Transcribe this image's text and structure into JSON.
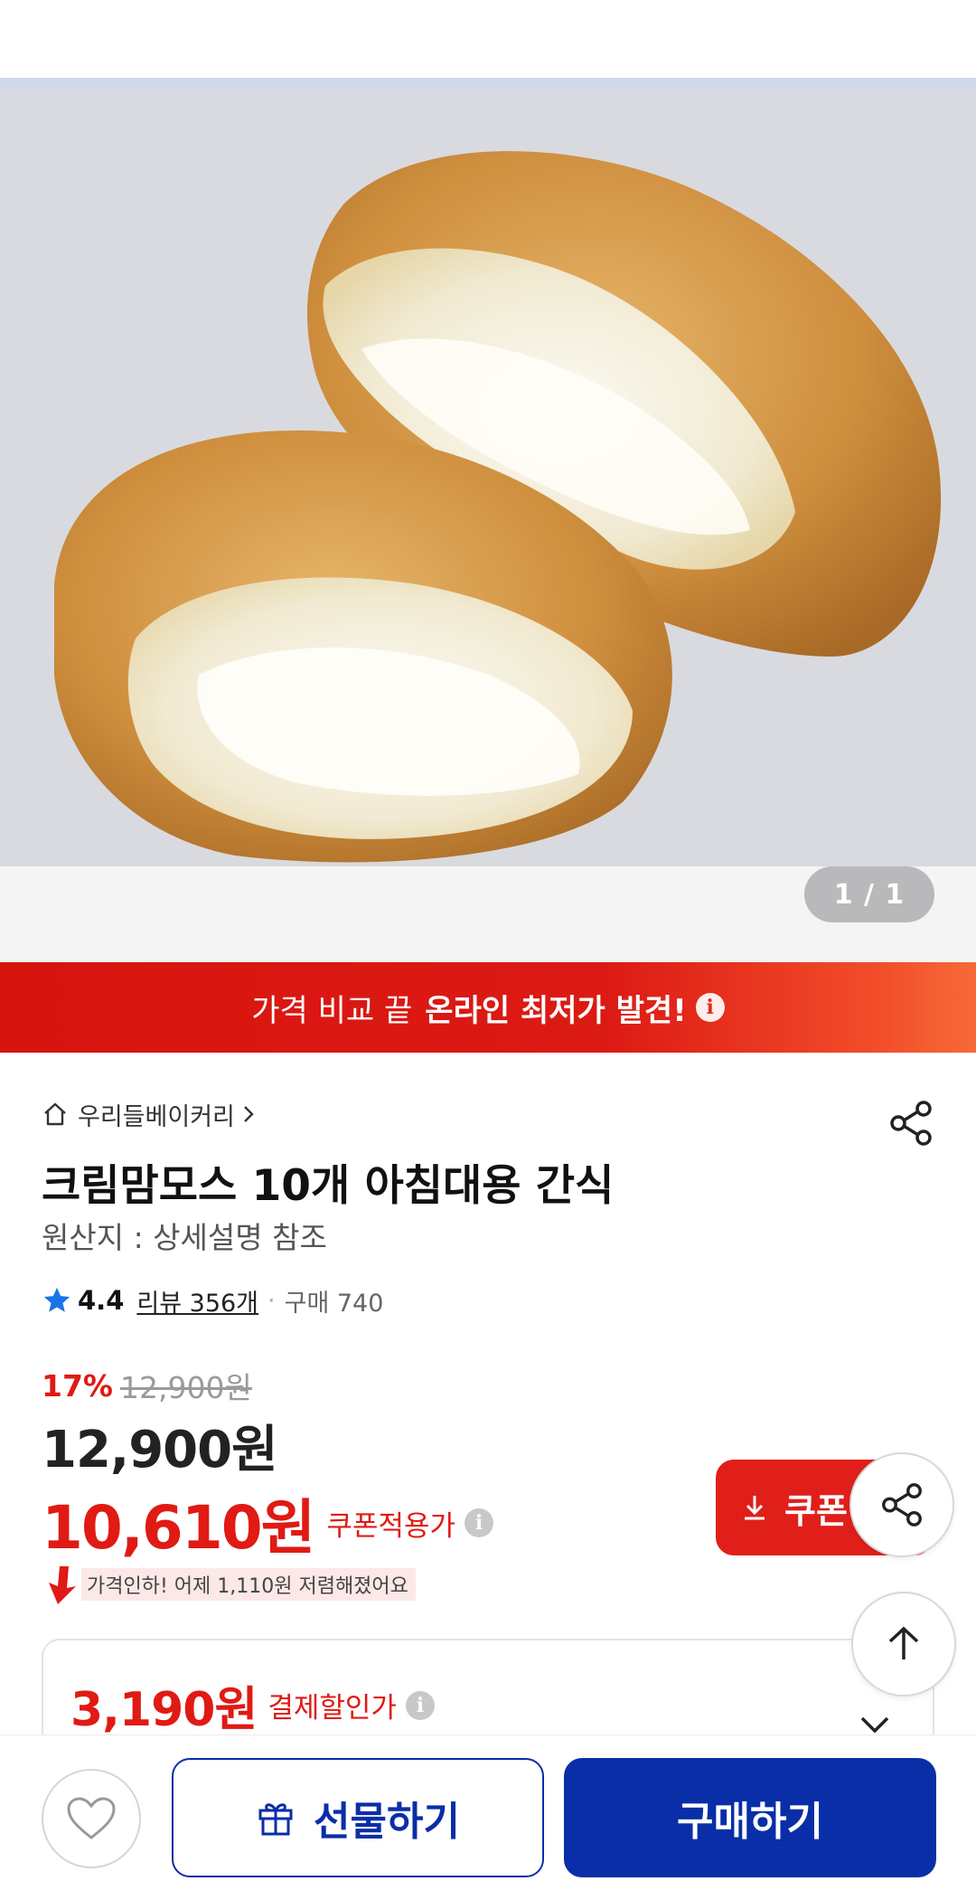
{
  "gallery": {
    "image_alt": "cream mammoth bread",
    "counter": "1 / 1"
  },
  "banner": {
    "text_normal": "가격 비교 끝",
    "text_strong": "온라인 최저가 발견!",
    "info_glyph": "i"
  },
  "product": {
    "store_name": "우리들베이커리",
    "title": "크림맘모스 10개 아침대용 간식",
    "origin": "원산지 : 상세설명 참조",
    "rating": "4.4",
    "reviews": "리뷰 356개",
    "separator": "·",
    "purchases": "구매 740"
  },
  "pricing": {
    "discount_pct": "17%",
    "original_price": "12,900원",
    "price": "12,900원",
    "coupon_price": "10,610원",
    "coupon_label": "쿠폰적용가",
    "coupon_button": "쿠폰받",
    "price_drop_note": "가격인하! 어제 1,110원 저렴해졌어요",
    "payment_price": "3,190원",
    "payment_label": "결제할인가",
    "info_glyph": "i"
  },
  "bottom_bar": {
    "gift_label": "선물하기",
    "buy_label": "구매하기"
  },
  "colors": {
    "accent_red": "#e01a14",
    "brand_blue": "#0a2ea8",
    "star_blue": "#1a73e8"
  }
}
